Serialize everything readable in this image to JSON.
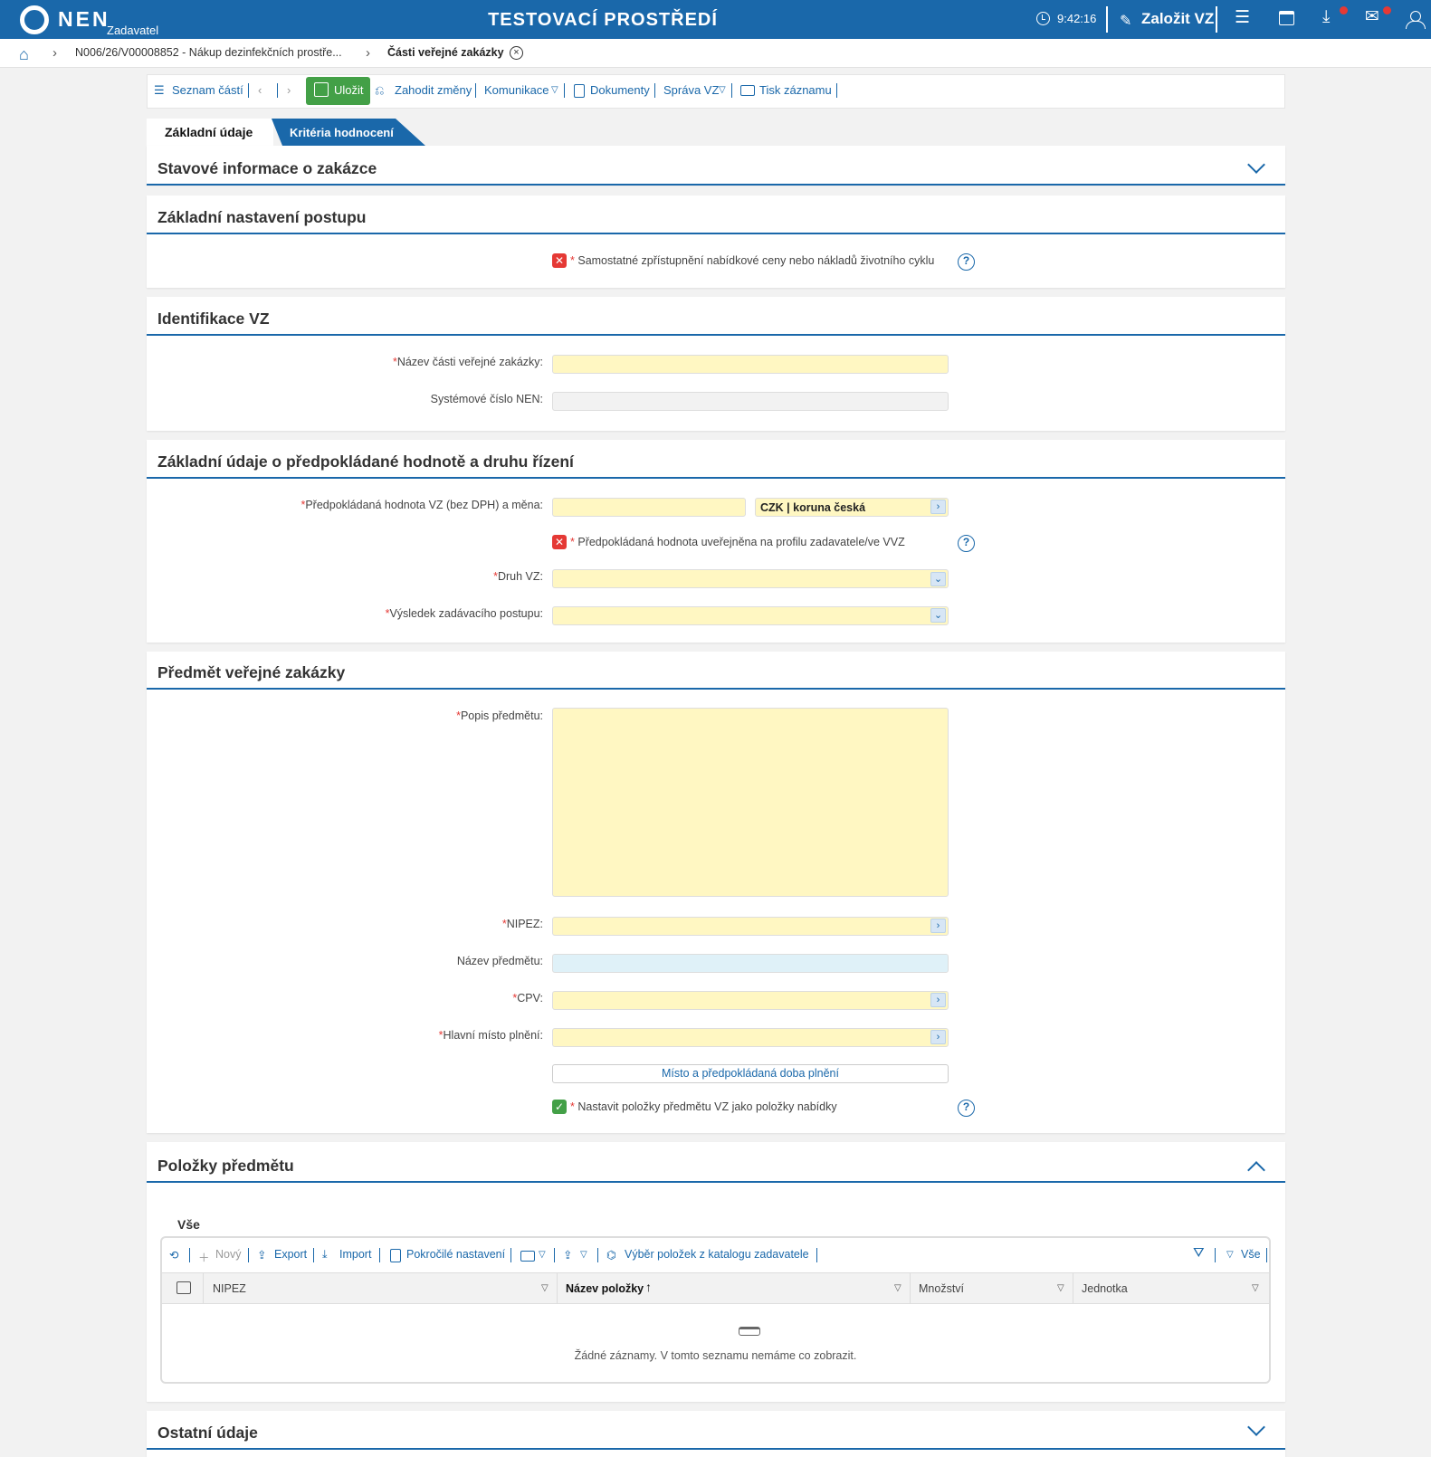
{
  "header": {
    "logo_text": "NEN",
    "logo_sub": "Zadavatel",
    "env_title": "TESTOVACÍ PROSTŘEDÍ",
    "time": "9:42:16",
    "create_label": "Založit VZ",
    "icons": [
      "clock-icon",
      "edit-icon",
      "menu-icon",
      "calendar-icon",
      "download-icon",
      "mail-icon",
      "user-icon"
    ]
  },
  "breadcrumb": {
    "item1": "N006/26/V00008852 - Nákup dezinfekčních prostře...",
    "item2": "Části veřejné zakázky",
    "close": "×"
  },
  "toolbar": {
    "parts_list": "Seznam částí",
    "save": "Uložit",
    "discard": "Zahodit změny",
    "communication": "Komunikace",
    "documents": "Dokumenty",
    "management": "Správa VZ",
    "print": "Tisk záznamu"
  },
  "tabs": {
    "basic": "Základní údaje",
    "criteria": "Kritéria hodnocení"
  },
  "sections": {
    "status": "Stavové informace o zakázce",
    "basic_settings": "Základní nastavení postupu",
    "identification": "Identifikace VZ",
    "value": "Základní údaje o předpokládané hodnotě a druhu řízení",
    "subject": "Předmět veřejné zakázky",
    "items": "Položky předmětu",
    "other": "Ostatní údaje"
  },
  "fields": {
    "separate_access": "Samostatné zpřístupnění nabídkové ceny nebo nákladů životního cyklu",
    "part_name": "Název části veřejné zakázky:",
    "system_number": "Systémové číslo NEN:",
    "estimated_value": "Předpokládaná hodnota VZ (bez DPH) a měna:",
    "currency": "CZK | koruna česká",
    "value_published": "Předpokládaná hodnota uveřejněna na profilu zadavatele/ve VVZ",
    "type": "Druh VZ:",
    "result": "Výsledek zadávacího postupu:",
    "description": "Popis předmětu:",
    "nipez": "NIPEZ:",
    "subject_name": "Název předmětu:",
    "cpv": "CPV:",
    "place": "Hlavní místo plnění:",
    "place_button": "Místo a předpokládaná doba plnění",
    "set_items": "Nastavit položky předmětu VZ jako položky nabídky",
    "required_mark": "*",
    "help_mark": "?"
  },
  "grid": {
    "subtab": "Vše",
    "new": "Nový",
    "export": "Export",
    "import": "Import",
    "advanced": "Pokročilé nastavení",
    "catalog": "Výběr položek z katalogu zadavatele",
    "filter_all": "Vše",
    "columns": [
      "NIPEZ",
      "Název položky",
      "Množství",
      "Jednotka"
    ],
    "empty": "Žádné záznamy. V tomto seznamu nemáme co zobrazit."
  },
  "colors": {
    "brand": "#1a68aa",
    "save": "#43a047",
    "required_input": "#fff7c2",
    "error": "#e53935"
  }
}
